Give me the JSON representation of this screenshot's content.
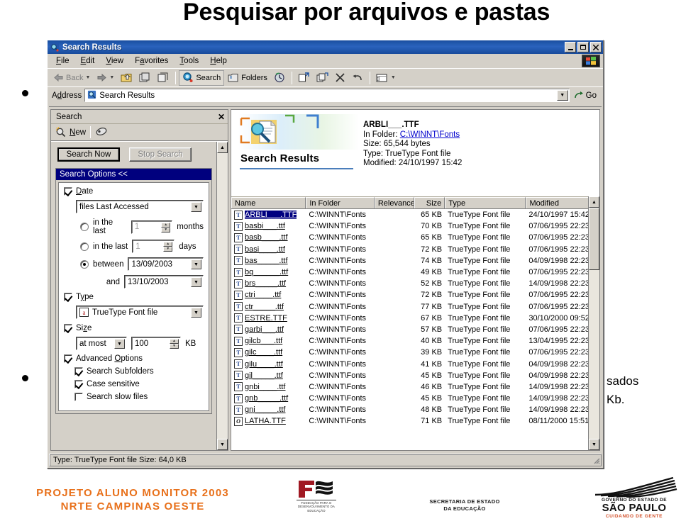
{
  "slide": {
    "title": "Pesquisar por arquivos e pastas",
    "bullet_fragment_1": "sados",
    "bullet_fragment_2": "Kb."
  },
  "footer": {
    "project_line1": "PROJETO ALUNO MONITOR 2003",
    "project_line2": "NRTE CAMPINAS OESTE",
    "fde_caption_1": "FUNDAÇÃO PARA O",
    "fde_caption_2": "DESENVOLVIMENTO DA",
    "fde_caption_3": "EDUCAÇÃO",
    "secretaria_line1": "SECRETARIA DE ESTADO",
    "secretaria_line2": "DA EDUCAÇÃO",
    "sp_line1": "GOVERNO DO ESTADO DE",
    "sp_line2": "SÃO PAULO",
    "sp_line3": "CUIDANDO DE GENTE",
    "accent_color": "#E8701A"
  },
  "window": {
    "title": "Search Results",
    "title_icon": "search-results-icon",
    "buttons": {
      "minimize": "_",
      "maximize": "□",
      "close": "✕"
    },
    "menu": [
      "File",
      "Edit",
      "View",
      "Favorites",
      "Tools",
      "Help"
    ],
    "toolbar": {
      "back": "Back",
      "forward": "",
      "search": "Search",
      "folders": "Folders",
      "items": [
        "back-icon",
        "forward-icon",
        "up-icon",
        "move-to-icon",
        "copy-to-icon",
        "history-icon",
        "move-icon",
        "copy-icon",
        "delete-icon",
        "undo-icon",
        "views-icon"
      ]
    },
    "address": {
      "label": "Address",
      "value": "Search Results",
      "go_label": "Go"
    },
    "statusbar": {
      "text": "Type: TrueType Font file Size: 64,0 KB"
    }
  },
  "search_pane": {
    "header": "Search",
    "close_icon": "close-icon",
    "new_label": "New",
    "buttons": {
      "search_now": "Search Now",
      "stop_search": "Stop Search"
    },
    "options_header": "Search Options  <<",
    "date": {
      "label": "Date",
      "checked": true,
      "criterion": "files Last Accessed",
      "in_last_months_label": "in the last",
      "months_value": "1",
      "months_unit": "months",
      "in_last_days_label": "in the last",
      "days_value": "1",
      "days_unit": "days",
      "between_label": "between",
      "between_value": "13/09/2003",
      "and_label": "and",
      "and_value": "13/10/2003"
    },
    "type": {
      "label": "Type",
      "checked": true,
      "value": "TrueType Font file"
    },
    "size": {
      "label": "Size",
      "checked": true,
      "operator": "at most",
      "value": "100",
      "unit": "KB"
    },
    "advanced": {
      "label": "Advanced Options",
      "checked": true,
      "search_subfolders": "Search Subfolders",
      "case_sensitive": "Case sensitive",
      "search_slow_files": "Search slow files"
    }
  },
  "results": {
    "banner_title": "Search Results",
    "banner_icon": "search-results-banner-icon",
    "detail": {
      "filename": "ARBLI___.TTF",
      "in_folder_label": "In Folder:",
      "in_folder_value": "C:\\WINNT\\Fonts",
      "size_label": "Size:",
      "size_value": "65,544 bytes",
      "type_label": "Type:",
      "type_value": "TrueType Font file",
      "modified_label": "Modified:",
      "modified_value": "24/10/1997 15:42"
    },
    "columns": [
      "Name",
      "In Folder",
      "Relevance",
      "Size",
      "Type",
      "Modified"
    ],
    "rows": [
      {
        "icon": "truetype-font-icon",
        "name": "ARBLI___.TTF",
        "folder": "C:\\WINNT\\Fonts",
        "relevance": "",
        "size": "65 KB",
        "type": "TrueType Font file",
        "modified": "24/10/1997 15:42",
        "selected": true
      },
      {
        "icon": "truetype-font-icon",
        "name": "basbi___.ttf",
        "folder": "C:\\WINNT\\Fonts",
        "relevance": "",
        "size": "70 KB",
        "type": "TrueType Font file",
        "modified": "07/06/1995 22:23",
        "selected": false
      },
      {
        "icon": "truetype-font-icon",
        "name": "basb____.ttf",
        "folder": "C:\\WINNT\\Fonts",
        "relevance": "",
        "size": "65 KB",
        "type": "TrueType Font file",
        "modified": "07/06/1995 22:23",
        "selected": false
      },
      {
        "icon": "truetype-font-icon",
        "name": "basi____.ttf",
        "folder": "C:\\WINNT\\Fonts",
        "relevance": "",
        "size": "72 KB",
        "type": "TrueType Font file",
        "modified": "07/06/1995 22:23",
        "selected": false
      },
      {
        "icon": "truetype-font-icon",
        "name": "bas_____.ttf",
        "folder": "C:\\WINNT\\Fonts",
        "relevance": "",
        "size": "74 KB",
        "type": "TrueType Font file",
        "modified": "04/09/1998 22:23",
        "selected": false
      },
      {
        "icon": "truetype-font-icon",
        "name": "bq______.ttf",
        "folder": "C:\\WINNT\\Fonts",
        "relevance": "",
        "size": "49 KB",
        "type": "TrueType Font file",
        "modified": "07/06/1995 22:23",
        "selected": false
      },
      {
        "icon": "truetype-font-icon",
        "name": "brs_____.ttf",
        "folder": "C:\\WINNT\\Fonts",
        "relevance": "",
        "size": "52 KB",
        "type": "TrueType Font file",
        "modified": "14/09/1998 22:23",
        "selected": false
      },
      {
        "icon": "truetype-font-icon",
        "name": "ctri____.ttf",
        "folder": "C:\\WINNT\\Fonts",
        "relevance": "",
        "size": "72 KB",
        "type": "TrueType Font file",
        "modified": "07/06/1995 22:23",
        "selected": false
      },
      {
        "icon": "truetype-font-icon",
        "name": "ctr_____.ttf",
        "folder": "C:\\WINNT\\Fonts",
        "relevance": "",
        "size": "77 KB",
        "type": "TrueType Font file",
        "modified": "07/06/1995 22:23",
        "selected": false
      },
      {
        "icon": "truetype-font-icon",
        "name": "ESTRE.TTF",
        "folder": "C:\\WINNT\\Fonts",
        "relevance": "",
        "size": "67 KB",
        "type": "TrueType Font file",
        "modified": "30/10/2000 09:52",
        "selected": false
      },
      {
        "icon": "truetype-font-icon",
        "name": "garbi___.ttf",
        "folder": "C:\\WINNT\\Fonts",
        "relevance": "",
        "size": "57 KB",
        "type": "TrueType Font file",
        "modified": "07/06/1995 22:23",
        "selected": false
      },
      {
        "icon": "truetype-font-icon",
        "name": "gilcb___.ttf",
        "folder": "C:\\WINNT\\Fonts",
        "relevance": "",
        "size": "40 KB",
        "type": "TrueType Font file",
        "modified": "13/04/1995 22:23",
        "selected": false
      },
      {
        "icon": "truetype-font-icon",
        "name": "gilc____.ttf",
        "folder": "C:\\WINNT\\Fonts",
        "relevance": "",
        "size": "39 KB",
        "type": "TrueType Font file",
        "modified": "07/06/1995 22:23",
        "selected": false
      },
      {
        "icon": "truetype-font-icon",
        "name": "gilu____.ttf",
        "folder": "C:\\WINNT\\Fonts",
        "relevance": "",
        "size": "41 KB",
        "type": "TrueType Font file",
        "modified": "04/09/1998 22:23",
        "selected": false
      },
      {
        "icon": "truetype-font-icon",
        "name": "gil_____.ttf",
        "folder": "C:\\WINNT\\Fonts",
        "relevance": "",
        "size": "45 KB",
        "type": "TrueType Font file",
        "modified": "04/09/1998 22:23",
        "selected": false
      },
      {
        "icon": "truetype-font-icon",
        "name": "gnbi____.ttf",
        "folder": "C:\\WINNT\\Fonts",
        "relevance": "",
        "size": "46 KB",
        "type": "TrueType Font file",
        "modified": "14/09/1998 22:23",
        "selected": false
      },
      {
        "icon": "truetype-font-icon",
        "name": "gnb_____.ttf",
        "folder": "C:\\WINNT\\Fonts",
        "relevance": "",
        "size": "45 KB",
        "type": "TrueType Font file",
        "modified": "14/09/1998 22:23",
        "selected": false
      },
      {
        "icon": "truetype-font-icon",
        "name": "gni_____.ttf",
        "folder": "C:\\WINNT\\Fonts",
        "relevance": "",
        "size": "48 KB",
        "type": "TrueType Font file",
        "modified": "14/09/1998 22:23",
        "selected": false
      },
      {
        "icon": "opentype-font-icon",
        "name": "LATHA.TTF",
        "folder": "C:\\WINNT\\Fonts",
        "relevance": "",
        "size": "71 KB",
        "type": "TrueType Font file",
        "modified": "08/11/2000 15:51",
        "selected": false
      }
    ]
  }
}
